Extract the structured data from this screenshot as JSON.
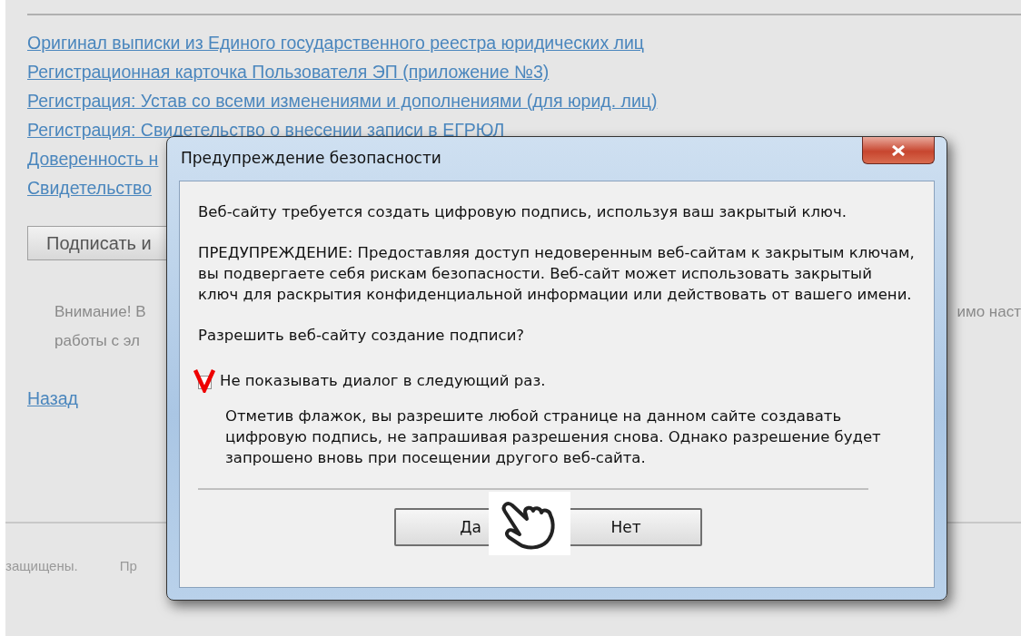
{
  "page": {
    "links": [
      "Оригинал выписки из Единого государственного реестра юридических лиц",
      "Регистрационная карточка Пользователя ЭП (приложение №3)",
      "Регистрация: Устав со всеми изменениями и дополнениями (для юрид. лиц)",
      "Регистрация: Свидетельство о внесении записи в ЕГРЮЛ",
      "Доверенность н",
      "Свидетельство"
    ],
    "sign_button": "Подписать и",
    "notice": [
      {
        "left": "Внимание! В",
        "right": "имо наст"
      },
      {
        "left": "работы с эл"
      }
    ],
    "back_link": "Назад",
    "footer": [
      "защищены.",
      "Пр"
    ]
  },
  "dialog": {
    "title": "Предупреждение безопасности",
    "message": "Веб-сайту требуется создать цифровую подпись, используя ваш закрытый ключ.",
    "warning": "ПРЕДУПРЕЖДЕНИЕ: Предоставляя доступ недоверенным веб-сайтам к закрытым ключам, вы подвергаете себя рискам безопасности. Веб-сайт может использовать закрытый ключ для раскрытия конфиденциальной информации или действовать от вашего имени.",
    "question": "Разрешить веб-сайту создание подписи?",
    "checkbox": {
      "label": "Не показывать диалог в следующий раз.",
      "checked": true
    },
    "hint": "Отметив флажок, вы разрешите любой странице на данном сайте создавать цифровую подпись, не запрашивая разрешения снова. Однако разрешение будет запрошено вновь при посещении другого веб-сайта.",
    "buttons": [
      "Да",
      "Нет"
    ]
  }
}
